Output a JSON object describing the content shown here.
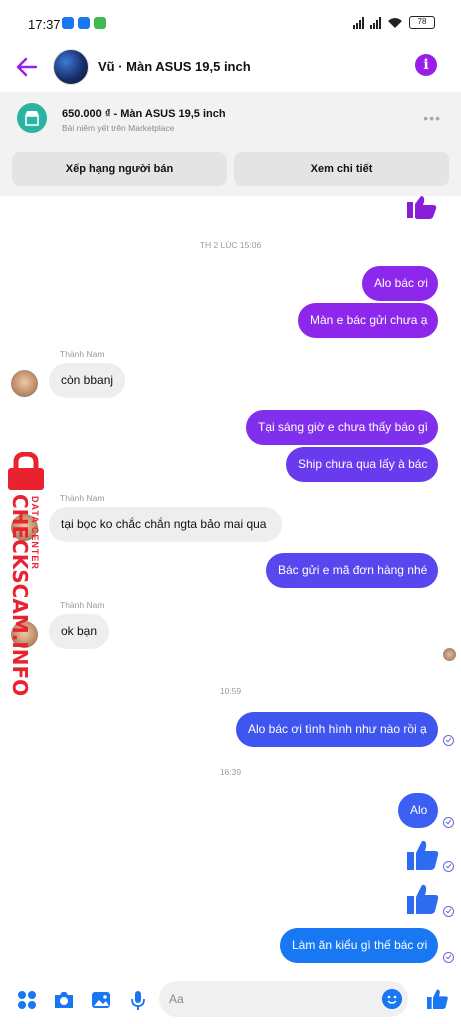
{
  "status_bar": {
    "time": "17:37",
    "battery": "78"
  },
  "header": {
    "title": "Vũ · Màn ASUS 19,5 inch"
  },
  "marketplace": {
    "title": "650.000 ₫ - Màn ASUS 19,5 inch",
    "subtitle": "Bài niêm yết trên Marketplace",
    "rate_seller_label": "Xếp hạng người bán",
    "view_details_label": "Xem chi tiết"
  },
  "messages": {
    "ts1": "TH 2 LÚC 15:06",
    "m1": "Alo bác ơi",
    "m2": "Màn e bác gửi chưa ạ",
    "sender1": "Thành Nam",
    "m3": "còn bbanj",
    "m4": "Tại sáng giờ e chưa thấy báo gì",
    "m5": "Ship chưa qua lấy à bác",
    "sender2": "Thành Nam",
    "m6": "tại bọc ko chắc chắn ngta bảo mai qua",
    "m7": "Bác gửi e mã đơn hàng nhé",
    "sender3": "Thành Nam",
    "m8": "ok bạn",
    "ts2": "10:59",
    "m9": "Alo bác ơi tình hình như nào rồi ạ",
    "ts3": "16:39",
    "m10": "Alo",
    "m11": "Làm ăn kiểu gì thế bác ơi"
  },
  "watermark": {
    "main": "CHECKSCAM.INFO",
    "sub": "DATA CENTER"
  },
  "composer": {
    "placeholder": "Aa"
  },
  "colors": {
    "purple": "#9b1ee8",
    "violet": "#7b2ff0",
    "blue": "#3d4ff0",
    "messenger_blue": "#1877f2",
    "watermark_red": "#e8232f"
  }
}
